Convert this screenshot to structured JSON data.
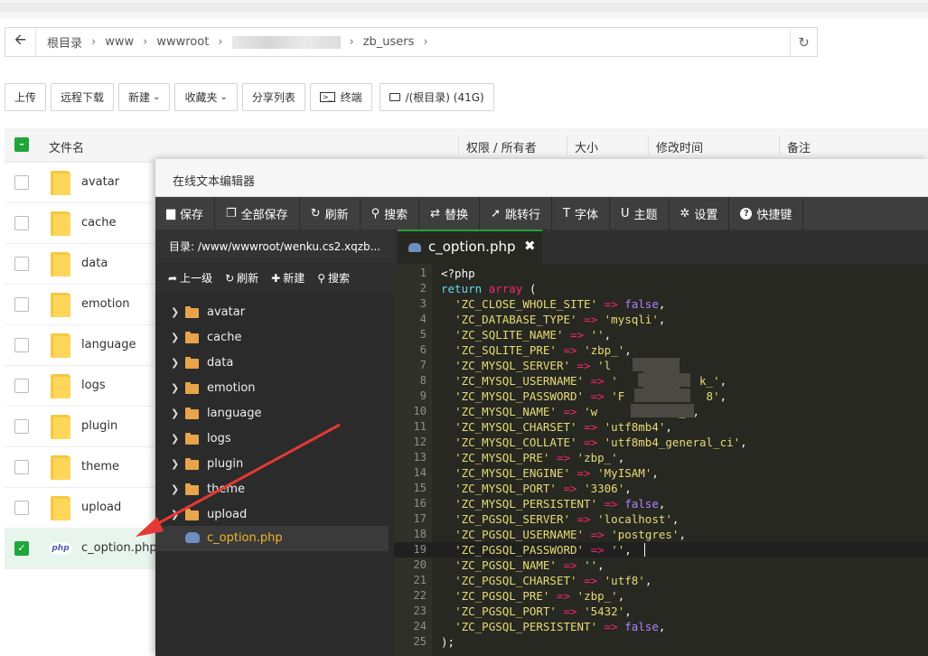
{
  "pathbar": {
    "crumbs": [
      "根目录",
      "www",
      "wwwroot",
      "zb_users"
    ],
    "back_icon": "arrow-left-icon",
    "refresh_icon": "refresh-icon"
  },
  "toolbar": {
    "upload": "上传",
    "remote_download": "远程下载",
    "new": "新建",
    "favorites": "收藏夹",
    "share_list": "分享列表",
    "terminal": "终端",
    "disk": "/(根目录) (41G)"
  },
  "file_table": {
    "headers": {
      "name": "文件名",
      "perm": "权限 / 所有者",
      "size": "大小",
      "mtime": "修改时间",
      "note": "备注"
    },
    "rows": [
      {
        "name": "avatar",
        "type": "folder",
        "checked": false
      },
      {
        "name": "cache",
        "type": "folder",
        "checked": false
      },
      {
        "name": "data",
        "type": "folder",
        "checked": false
      },
      {
        "name": "emotion",
        "type": "folder",
        "checked": false
      },
      {
        "name": "language",
        "type": "folder",
        "checked": false
      },
      {
        "name": "logs",
        "type": "folder",
        "checked": false
      },
      {
        "name": "plugin",
        "type": "folder",
        "checked": false
      },
      {
        "name": "theme",
        "type": "folder",
        "checked": false
      },
      {
        "name": "upload",
        "type": "folder",
        "checked": false
      },
      {
        "name": "c_option.php",
        "type": "php",
        "checked": true
      }
    ],
    "php_badge": "php"
  },
  "editor": {
    "title": "在线文本编辑器",
    "tools": [
      {
        "icon": "save-icon",
        "label": "保存"
      },
      {
        "icon": "save-all-icon",
        "label": "全部保存"
      },
      {
        "icon": "refresh-icon",
        "label": "刷新"
      },
      {
        "icon": "search-icon",
        "label": "搜索"
      },
      {
        "icon": "replace-icon",
        "label": "替换"
      },
      {
        "icon": "jump-icon",
        "label": "跳转行"
      },
      {
        "icon": "font-icon",
        "label": "字体"
      },
      {
        "icon": "theme-icon",
        "label": "主题"
      },
      {
        "icon": "gear-icon",
        "label": "设置"
      },
      {
        "icon": "help-icon",
        "label": "快捷键"
      }
    ],
    "dir_label": "目录: /www/wwwroot/wenku.cs2.xqzb...",
    "side_actions": {
      "up": "上一级",
      "refresh": "刷新",
      "new": "新建",
      "search": "搜索"
    },
    "tree": [
      "avatar",
      "cache",
      "data",
      "emotion",
      "language",
      "logs",
      "plugin",
      "theme",
      "upload"
    ],
    "tree_file": "c_option.php",
    "tab_name": "c_option.php",
    "code_lines": [
      [
        [
          "plain",
          "<?php"
        ]
      ],
      [
        [
          "kw",
          "return"
        ],
        [
          "plain",
          " "
        ],
        [
          "op",
          "array"
        ],
        [
          "plain",
          " ("
        ]
      ],
      [
        [
          "plain",
          "  "
        ],
        [
          "str",
          "'ZC_CLOSE_WHOLE_SITE'"
        ],
        [
          "plain",
          " "
        ],
        [
          "op",
          "=>"
        ],
        [
          "plain",
          " "
        ],
        [
          "bool",
          "false"
        ],
        [
          "plain",
          ","
        ]
      ],
      [
        [
          "plain",
          "  "
        ],
        [
          "str",
          "'ZC_DATABASE_TYPE'"
        ],
        [
          "plain",
          " "
        ],
        [
          "op",
          "=>"
        ],
        [
          "plain",
          " "
        ],
        [
          "str",
          "'mysqli'"
        ],
        [
          "plain",
          ","
        ]
      ],
      [
        [
          "plain",
          "  "
        ],
        [
          "str",
          "'ZC_SQLITE_NAME'"
        ],
        [
          "plain",
          " "
        ],
        [
          "op",
          "=>"
        ],
        [
          "plain",
          " "
        ],
        [
          "str",
          "''"
        ],
        [
          "plain",
          ","
        ]
      ],
      [
        [
          "plain",
          "  "
        ],
        [
          "str",
          "'ZC_SQLITE_PRE'"
        ],
        [
          "plain",
          " "
        ],
        [
          "op",
          "=>"
        ],
        [
          "plain",
          " "
        ],
        [
          "str",
          "'zbp_'"
        ],
        [
          "plain",
          ","
        ]
      ],
      [
        [
          "plain",
          "  "
        ],
        [
          "str",
          "'ZC_MYSQL_SERVER'"
        ],
        [
          "plain",
          " "
        ],
        [
          "op",
          "=>"
        ],
        [
          "plain",
          " "
        ],
        [
          "str",
          "'l         '"
        ]
      ],
      [
        [
          "plain",
          "  "
        ],
        [
          "str",
          "'ZC_MYSQL_USERNAME'"
        ],
        [
          "plain",
          " "
        ],
        [
          "op",
          "=>"
        ],
        [
          "plain",
          " "
        ],
        [
          "str",
          "'            k_'"
        ],
        [
          "plain",
          ","
        ]
      ],
      [
        [
          "plain",
          "  "
        ],
        [
          "str",
          "'ZC_MYSQL_PASSWORD'"
        ],
        [
          "plain",
          " "
        ],
        [
          "op",
          "=>"
        ],
        [
          "plain",
          " "
        ],
        [
          "str",
          "'F            8'"
        ],
        [
          "plain",
          ","
        ]
      ],
      [
        [
          "plain",
          "  "
        ],
        [
          "str",
          "'ZC_MYSQL_NAME'"
        ],
        [
          "plain",
          " "
        ],
        [
          "op",
          "=>"
        ],
        [
          "plain",
          " "
        ],
        [
          "str",
          "'w            _'"
        ],
        [
          "plain",
          ","
        ]
      ],
      [
        [
          "plain",
          "  "
        ],
        [
          "str",
          "'ZC_MYSQL_CHARSET'"
        ],
        [
          "plain",
          " "
        ],
        [
          "op",
          "=>"
        ],
        [
          "plain",
          " "
        ],
        [
          "str",
          "'utf8mb4'"
        ],
        [
          "plain",
          ","
        ]
      ],
      [
        [
          "plain",
          "  "
        ],
        [
          "str",
          "'ZC_MYSQL_COLLATE'"
        ],
        [
          "plain",
          " "
        ],
        [
          "op",
          "=>"
        ],
        [
          "plain",
          " "
        ],
        [
          "str",
          "'utf8mb4_general_ci'"
        ],
        [
          "plain",
          ","
        ]
      ],
      [
        [
          "plain",
          "  "
        ],
        [
          "str",
          "'ZC_MYSQL_PRE'"
        ],
        [
          "plain",
          " "
        ],
        [
          "op",
          "=>"
        ],
        [
          "plain",
          " "
        ],
        [
          "str",
          "'zbp_'"
        ],
        [
          "plain",
          ","
        ]
      ],
      [
        [
          "plain",
          "  "
        ],
        [
          "str",
          "'ZC_MYSQL_ENGINE'"
        ],
        [
          "plain",
          " "
        ],
        [
          "op",
          "=>"
        ],
        [
          "plain",
          " "
        ],
        [
          "str",
          "'MyISAM'"
        ],
        [
          "plain",
          ","
        ]
      ],
      [
        [
          "plain",
          "  "
        ],
        [
          "str",
          "'ZC_MYSQL_PORT'"
        ],
        [
          "plain",
          " "
        ],
        [
          "op",
          "=>"
        ],
        [
          "plain",
          " "
        ],
        [
          "str",
          "'3306'"
        ],
        [
          "plain",
          ","
        ]
      ],
      [
        [
          "plain",
          "  "
        ],
        [
          "str",
          "'ZC_MYSQL_PERSISTENT'"
        ],
        [
          "plain",
          " "
        ],
        [
          "op",
          "=>"
        ],
        [
          "plain",
          " "
        ],
        [
          "bool",
          "false"
        ],
        [
          "plain",
          ","
        ]
      ],
      [
        [
          "plain",
          "  "
        ],
        [
          "str",
          "'ZC_PGSQL_SERVER'"
        ],
        [
          "plain",
          " "
        ],
        [
          "op",
          "=>"
        ],
        [
          "plain",
          " "
        ],
        [
          "str",
          "'localhost'"
        ],
        [
          "plain",
          ","
        ]
      ],
      [
        [
          "plain",
          "  "
        ],
        [
          "str",
          "'ZC_PGSQL_USERNAME'"
        ],
        [
          "plain",
          " "
        ],
        [
          "op",
          "=>"
        ],
        [
          "plain",
          " "
        ],
        [
          "str",
          "'postgres'"
        ],
        [
          "plain",
          ","
        ]
      ],
      [
        [
          "plain",
          "  "
        ],
        [
          "str",
          "'ZC_PGSQL_PASSWORD'"
        ],
        [
          "plain",
          " "
        ],
        [
          "op",
          "=>"
        ],
        [
          "plain",
          " "
        ],
        [
          "str",
          "''"
        ],
        [
          "plain",
          ","
        ]
      ],
      [
        [
          "plain",
          "  "
        ],
        [
          "str",
          "'ZC_PGSQL_NAME'"
        ],
        [
          "plain",
          " "
        ],
        [
          "op",
          "=>"
        ],
        [
          "plain",
          " "
        ],
        [
          "str",
          "''"
        ],
        [
          "plain",
          ","
        ]
      ],
      [
        [
          "plain",
          "  "
        ],
        [
          "str",
          "'ZC_PGSQL_CHARSET'"
        ],
        [
          "plain",
          " "
        ],
        [
          "op",
          "=>"
        ],
        [
          "plain",
          " "
        ],
        [
          "str",
          "'utf8'"
        ],
        [
          "plain",
          ","
        ]
      ],
      [
        [
          "plain",
          "  "
        ],
        [
          "str",
          "'ZC_PGSQL_PRE'"
        ],
        [
          "plain",
          " "
        ],
        [
          "op",
          "=>"
        ],
        [
          "plain",
          " "
        ],
        [
          "str",
          "'zbp_'"
        ],
        [
          "plain",
          ","
        ]
      ],
      [
        [
          "plain",
          "  "
        ],
        [
          "str",
          "'ZC_PGSQL_PORT'"
        ],
        [
          "plain",
          " "
        ],
        [
          "op",
          "=>"
        ],
        [
          "plain",
          " "
        ],
        [
          "str",
          "'5432'"
        ],
        [
          "plain",
          ","
        ]
      ],
      [
        [
          "plain",
          "  "
        ],
        [
          "str",
          "'ZC_PGSQL_PERSISTENT'"
        ],
        [
          "plain",
          " "
        ],
        [
          "op",
          "=>"
        ],
        [
          "plain",
          " "
        ],
        [
          "bool",
          "false"
        ],
        [
          "plain",
          ","
        ]
      ],
      [
        [
          "plain",
          ");"
        ]
      ]
    ]
  },
  "colors": {
    "accent_green": "#20a53a",
    "editor_bg": "#272822",
    "annotation_arrow": "#e53935"
  }
}
